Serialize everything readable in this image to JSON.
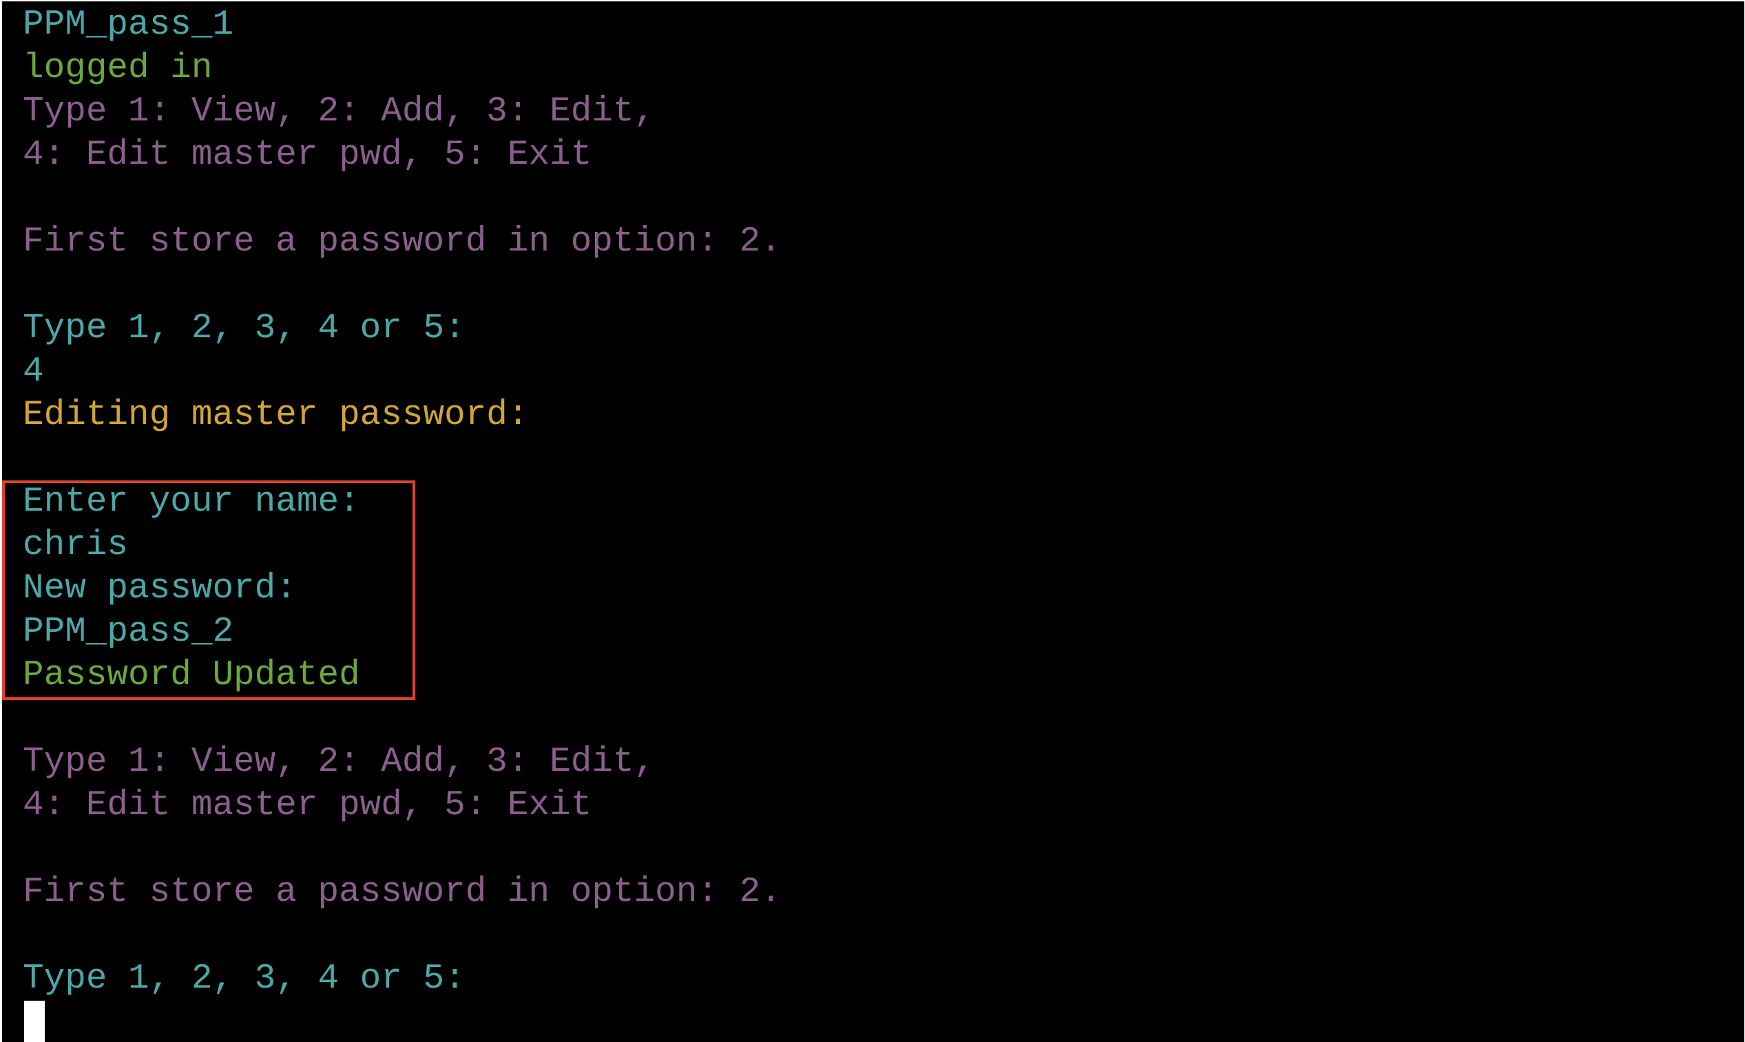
{
  "terminal": {
    "lines": [
      {
        "text": "PPM_pass_1",
        "color": "#4aa8a7"
      },
      {
        "text": "logged in",
        "color": "#6aa83c"
      },
      {
        "text": "Type 1: View, 2: Add, 3: Edit,",
        "color": "#8a5f8c"
      },
      {
        "text": "4: Edit master pwd, 5: Exit",
        "color": "#8a5f8c"
      },
      {
        "text": "",
        "color": ""
      },
      {
        "text": "First store a password in option: 2.",
        "color": "#8a5f8c"
      },
      {
        "text": "",
        "color": ""
      },
      {
        "text": "Type 1, 2, 3, 4 or 5:",
        "color": "#4aa8a7"
      },
      {
        "text": "4",
        "color": "#4aa8a7"
      },
      {
        "text": "Editing master password:",
        "color": "#d0a531"
      },
      {
        "text": "",
        "color": ""
      },
      {
        "text": "Enter your name:",
        "color": "#4aa8a7"
      },
      {
        "text": "chris",
        "color": "#4aa8a7"
      },
      {
        "text": "New password:",
        "color": "#4aa8a7"
      },
      {
        "text": "PPM_pass_2",
        "color": "#4aa8a7"
      },
      {
        "text": "Password Updated",
        "color": "#6aa83c"
      },
      {
        "text": "",
        "color": ""
      },
      {
        "text": "Type 1: View, 2: Add, 3: Edit,",
        "color": "#8a5f8c"
      },
      {
        "text": "4: Edit master pwd, 5: Exit",
        "color": "#8a5f8c"
      },
      {
        "text": "",
        "color": ""
      },
      {
        "text": "First store a password in option: 2.",
        "color": "#8a5f8c"
      },
      {
        "text": "",
        "color": ""
      },
      {
        "text": "Type 1, 2, 3, 4 or 5:",
        "color": "#4aa8a7"
      }
    ],
    "highlight_color": "#e0402c",
    "background": "#000000",
    "cursor_color": "#ffffff"
  }
}
